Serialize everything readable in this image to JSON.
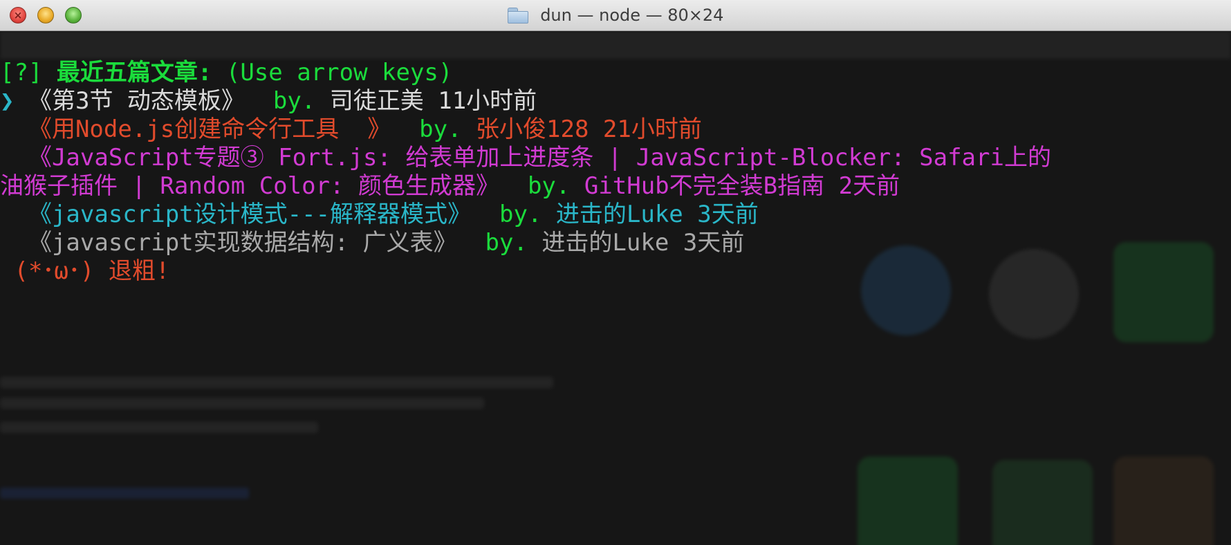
{
  "window": {
    "title": "dun — node — 80×24",
    "folder_icon": "folder-icon",
    "buttons": [
      "close-icon",
      "minimize-icon",
      "zoom-icon"
    ]
  },
  "colors": {
    "green": "#1bdc3c",
    "cyan": "#2ab6c8",
    "white": "#dadada",
    "red": "#e14b2c",
    "magenta": "#d13bd2",
    "gray": "#a9a9a9"
  },
  "prompt": {
    "marker": "[?]",
    "question": " 最近五篇文章:",
    "hint": " (Use arrow keys)"
  },
  "articles": [
    {
      "pointer": "❯",
      "open": " 《",
      "title": "第3节 动态模板",
      "close": "》",
      "by": "  by.",
      "author": " 司徒正美",
      "time": " 11小时前"
    },
    {
      "open": "  《",
      "title": "用Node.js创建命令行工具  ",
      "close": "》",
      "by": "  by.",
      "author": " 张小俊128",
      "time": " 21小时前"
    },
    {
      "open": "  《",
      "title_line1": "JavaScript专题③ Fort.js: 给表单加上进度条 | JavaScript-Blocker: Safari上的",
      "title_line2": "油猴子插件 | Random Color: 颜色生成器",
      "close": "》",
      "by": "  by.",
      "author": " GitHub不完全装B指南",
      "time": " 2天前"
    },
    {
      "open": "  《",
      "title": "javascript设计模式---解释器模式",
      "close": "》",
      "by": "  by.",
      "author": " 进击的Luke",
      "time": " 3天前"
    },
    {
      "open": "  《",
      "title": "javascript实现数据结构: 广义表",
      "close": "》",
      "by": "  by.",
      "author": " 进击的Luke",
      "time": " 3天前"
    }
  ],
  "exit_option": " (*･ω･) 退粗!"
}
